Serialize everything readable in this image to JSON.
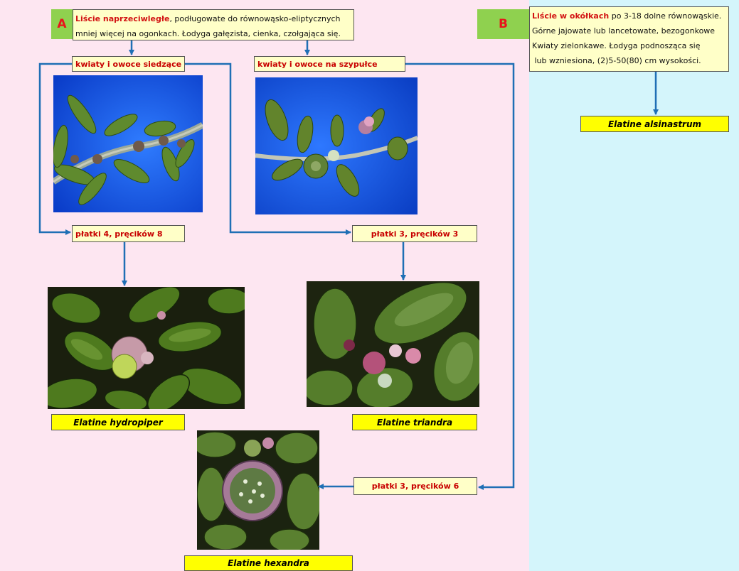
{
  "key_a": {
    "letter": "A",
    "title_em": "Liście naprzeciwległe",
    "title_rest": ", podługowate do równowąsko-eliptycznych",
    "line2": "mniej więcej na ogonkach. Łodyga gałęzista, cienka, czołgająca się."
  },
  "key_b": {
    "letter": "B",
    "title_em": "Liście w okółkach",
    "title_rest": " po 3-18 dolne równowąskie.",
    "line2": "Górne jajowate lub lancetowate, bezogonkowe",
    "line3": "Kwiaty zielonkawe. Łodyga podnosząca się",
    "line4": " lub wzniesiona, (2)5-50(80) cm wysokości."
  },
  "nodes": {
    "sessile": "kwiaty i owoce siedzące",
    "stalked": "kwiaty i owoce na szypułce",
    "petals4": "płatki 4, pręcików 8",
    "petals3_3": "płatki 3, pręcików 3",
    "petals3_6": "płatki 3, pręcików 6"
  },
  "species": {
    "alsinastrum": "Elatine alsinastrum",
    "hydropiper": "Elatine hydropiper",
    "triandra": "Elatine triandra",
    "hexandra": "Elatine hexandra"
  },
  "colors": {
    "left_panel": "#fde6f1",
    "right_panel": "#d4f5fb",
    "arrow": "#1f6fb5",
    "highlight": "#ffff00",
    "box": "#ffffc8"
  }
}
